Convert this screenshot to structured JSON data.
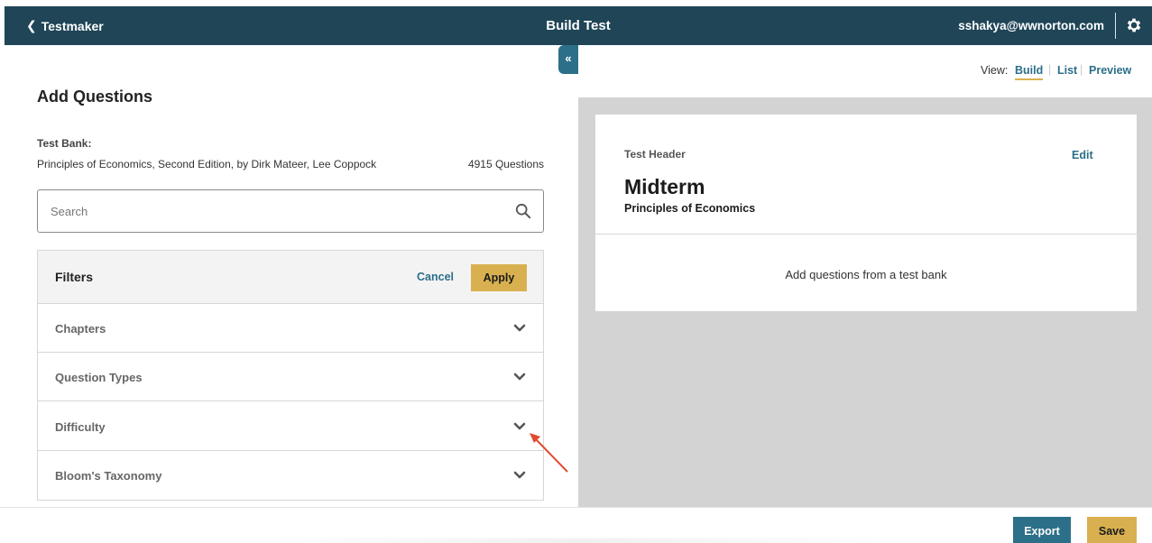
{
  "header": {
    "back_label": "Testmaker",
    "title": "Build Test",
    "user_email": "sshakya@wwnorton.com",
    "brand_color": "#1f4557"
  },
  "left": {
    "collapse_label": "«",
    "title": "Add Questions",
    "test_bank_label": "Test Bank:",
    "test_bank_name": "Principles of Economics, Second Edition, by Dirk Mateer, Lee Coppock",
    "question_count": "4915 Questions",
    "search": {
      "placeholder": "Search",
      "value": ""
    },
    "filters": {
      "title": "Filters",
      "cancel_label": "Cancel",
      "apply_label": "Apply",
      "items": [
        {
          "label": "Chapters"
        },
        {
          "label": "Question Types"
        },
        {
          "label": "Difficulty"
        },
        {
          "label": "Bloom's Taxonomy"
        }
      ]
    }
  },
  "right": {
    "view_label": "View:",
    "views": [
      "Build",
      "List",
      "Preview"
    ],
    "active_view": "Build",
    "card": {
      "header_label": "Test Header",
      "edit_label": "Edit",
      "title": "Midterm",
      "subtitle": "Principles of Economics",
      "empty_text": "Add questions from a test bank"
    }
  },
  "footer": {
    "export_label": "Export",
    "save_label": "Save"
  },
  "colors": {
    "accent": "#2c6f89",
    "apply_gold": "#d9b04f",
    "annotation_arrow": "#e04a2f"
  }
}
